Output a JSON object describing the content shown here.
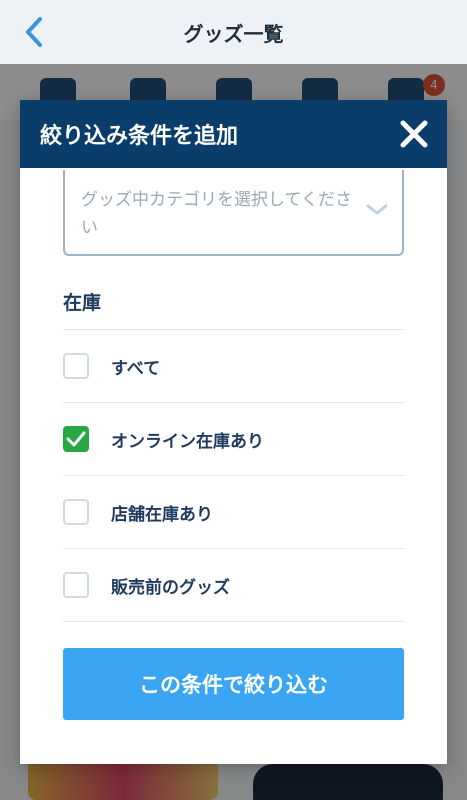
{
  "appbar": {
    "title": "グッズ一覧"
  },
  "cart": {
    "badge_count": "4"
  },
  "modal": {
    "title": "絞り込み条件を追加",
    "category_select": {
      "placeholder": "グッズ中カテゴリを選択してください"
    },
    "stock_section": {
      "title": "在庫",
      "options": [
        {
          "label": "すべて",
          "checked": false
        },
        {
          "label": "オンライン在庫あり",
          "checked": true
        },
        {
          "label": "店舗在庫あり",
          "checked": false
        },
        {
          "label": "販売前のグッズ",
          "checked": false
        }
      ]
    },
    "apply_label": "この条件で絞り込む"
  },
  "colors": {
    "header_navy": "#0b3d6b",
    "apply_blue": "#3aa6f3",
    "check_green": "#28a745",
    "badge_red": "#e15433"
  }
}
